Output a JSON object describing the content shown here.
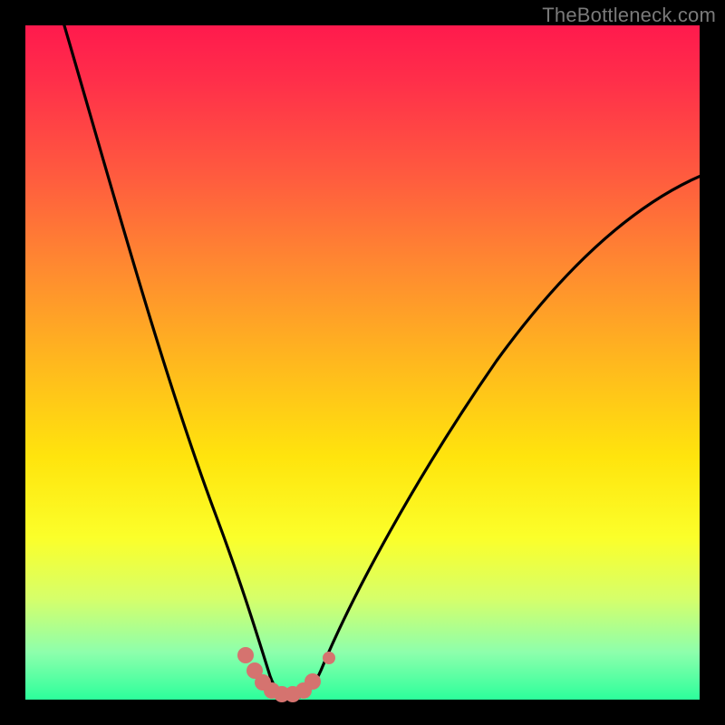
{
  "watermark": "TheBottleneck.com",
  "colors": {
    "background": "#000000",
    "gradient_top": "#ff1a4d",
    "gradient_bottom": "#2cff9b",
    "curve": "#000000",
    "markers": "#d5736f"
  },
  "chart_data": {
    "type": "line",
    "title": "",
    "xlabel": "",
    "ylabel": "",
    "xlim": [
      0,
      100
    ],
    "ylim": [
      0,
      100
    ],
    "series": [
      {
        "name": "main-curve",
        "x": [
          5,
          10,
          15,
          20,
          25,
          27,
          30,
          32,
          34,
          36,
          38,
          40,
          42,
          45,
          50,
          55,
          60,
          65,
          70,
          75,
          80,
          85,
          90,
          95,
          100
        ],
        "y": [
          100,
          80,
          60,
          42,
          26,
          20,
          12,
          7,
          3,
          1,
          0,
          0,
          1,
          4,
          12,
          21,
          30,
          38,
          46,
          53,
          59,
          64,
          68,
          71,
          73
        ]
      }
    ],
    "markers": [
      {
        "x": 31.5,
        "y": 6.0
      },
      {
        "x": 33.0,
        "y": 3.0
      },
      {
        "x": 34.0,
        "y": 1.5
      },
      {
        "x": 35.5,
        "y": 0.5
      },
      {
        "x": 37.0,
        "y": 0.2
      },
      {
        "x": 38.5,
        "y": 0.2
      },
      {
        "x": 40.0,
        "y": 0.5
      },
      {
        "x": 41.5,
        "y": 1.5
      },
      {
        "x": 43.5,
        "y": 4.5
      }
    ],
    "annotations": []
  }
}
